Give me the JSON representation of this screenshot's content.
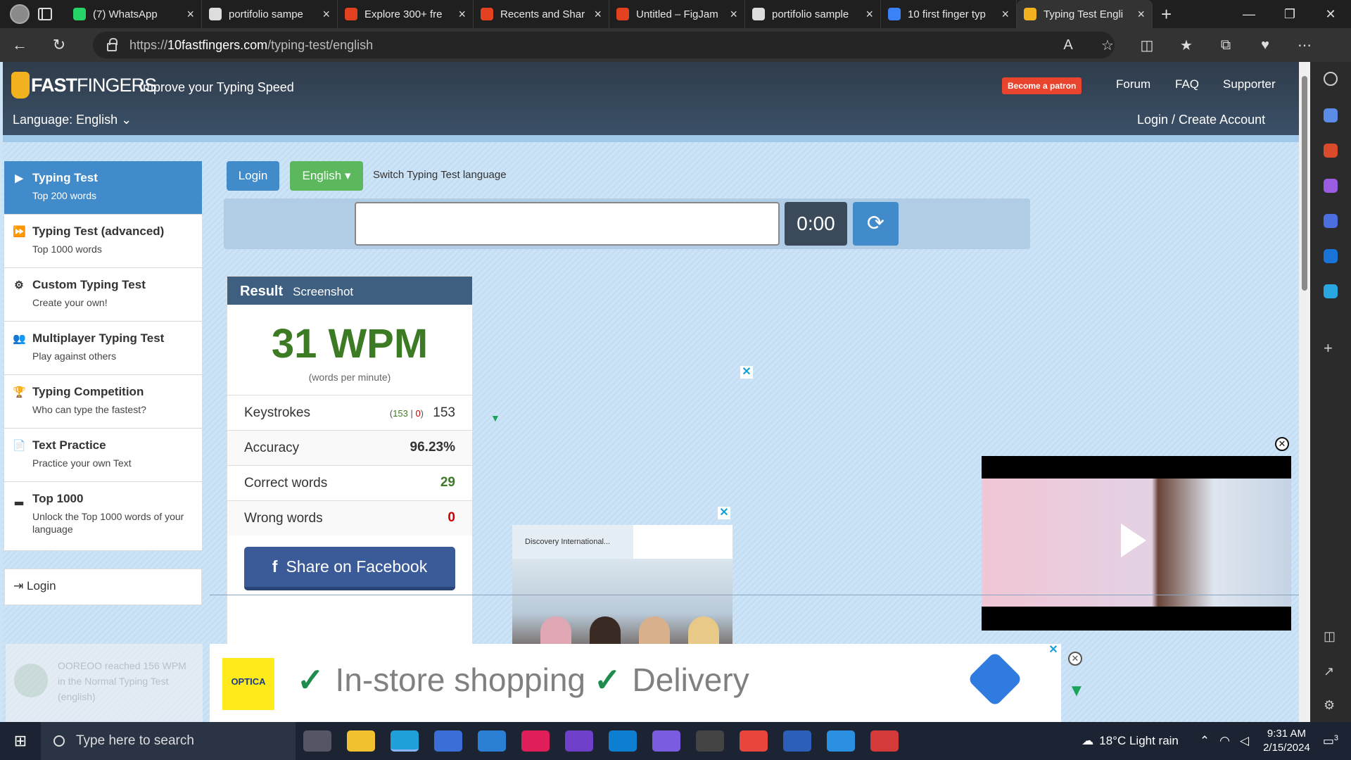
{
  "browser": {
    "tabs": [
      {
        "title": "(7) WhatsApp",
        "color": "#25d366"
      },
      {
        "title": "portifolio sampe",
        "color": "#ddd"
      },
      {
        "title": "Explore 300+ fre",
        "color": "#e2421f"
      },
      {
        "title": "Recents and Shar",
        "color": "#e2421f"
      },
      {
        "title": "Untitled – FigJam",
        "color": "#e2421f"
      },
      {
        "title": "portifolio sample",
        "color": "#ddd"
      },
      {
        "title": "10 first finger typ",
        "color": "#3b82f6"
      },
      {
        "title": "Typing Test Engli",
        "color": "#f2b220"
      }
    ],
    "url_prefix": "https://",
    "url_domain": "10fastfingers.com",
    "url_path": "/typing-test/english"
  },
  "site": {
    "logo_bold": "FAST",
    "logo_light": "FINGERS",
    "tagline": "Improve your Typing Speed",
    "patron": "Become a patron",
    "nav": [
      "Forum",
      "FAQ",
      "Supporter"
    ],
    "language": "Language: English",
    "login_create": "Login / Create Account"
  },
  "menu": [
    {
      "title": "Typing Test",
      "sub": "Top 200 words",
      "icon": "play-icon"
    },
    {
      "title": "Typing Test (advanced)",
      "sub": "Top 1000 words",
      "icon": "fast-forward-icon"
    },
    {
      "title": "Custom Typing Test",
      "sub": "Create your own!",
      "icon": "gears-icon"
    },
    {
      "title": "Multiplayer Typing Test",
      "sub": "Play against others",
      "icon": "users-icon"
    },
    {
      "title": "Typing Competition",
      "sub": "Who can type the fastest?",
      "icon": "trophy-icon"
    },
    {
      "title": "Text Practice",
      "sub": "Practice your own Text",
      "icon": "document-icon"
    },
    {
      "title": "Top 1000",
      "sub": "Unlock the Top 1000 words of your language",
      "icon": "signal-icon"
    }
  ],
  "menu_login": "Login",
  "controls": {
    "login": "Login",
    "language": "English",
    "switch_label": "Switch Typing Test language",
    "timer": "0:00"
  },
  "result": {
    "title": "Result",
    "screenshot": "Screenshot",
    "wpm": "31 WPM",
    "wpm_sub": "(words per minute)",
    "keystrokes_label": "Keystrokes",
    "keystrokes_correct": "153",
    "keystrokes_wrong": "0",
    "keystrokes_total": "153",
    "accuracy_label": "Accuracy",
    "accuracy": "96.23%",
    "correct_label": "Correct words",
    "correct": "29",
    "wrong_label": "Wrong words",
    "wrong": "0",
    "share": "Share on Facebook"
  },
  "ads": {
    "small_label": "Discovery International...",
    "optica": "OPTICA",
    "in_store": "In-store shopping",
    "delivery": "Delivery",
    "notif": "OOREOO reached 156 WPM in the Normal Typing Test (english)"
  },
  "taskbar": {
    "search": "Type here to search",
    "weather": "18°C  Light rain",
    "time": "9:31 AM",
    "date": "2/15/2024",
    "notif_count": "3"
  }
}
